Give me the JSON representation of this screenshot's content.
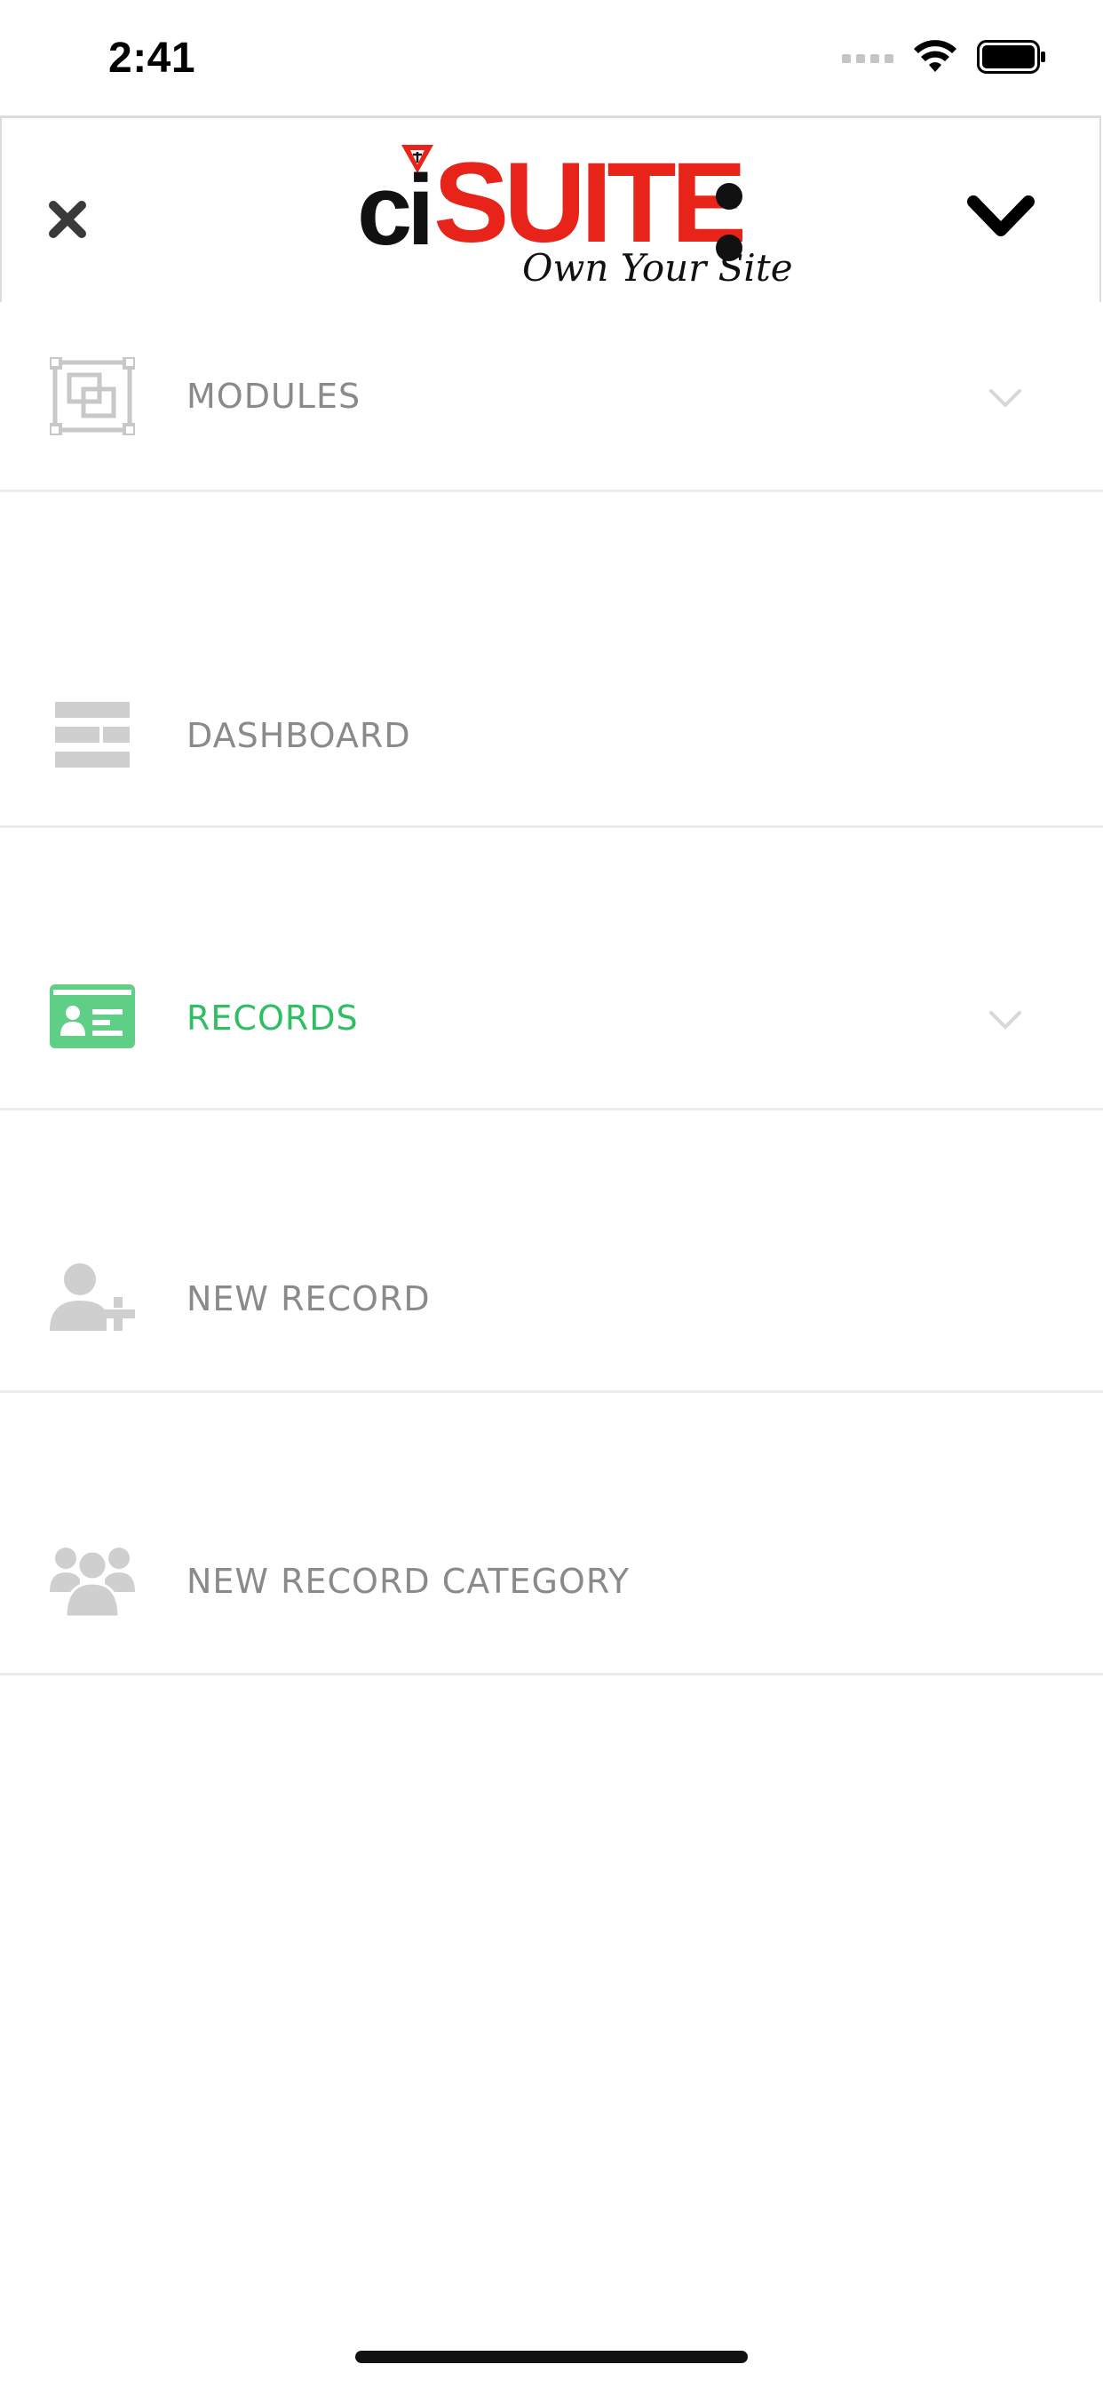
{
  "status_bar": {
    "time": "2:41"
  },
  "header": {
    "logo": {
      "brand_prefix": "ci",
      "brand_main": "SUITE",
      "tagline": "Own Your Site"
    },
    "close_icon": "close-icon",
    "collapse_icon": "chevron-down-icon"
  },
  "menu": {
    "items": [
      {
        "label": "MODULES",
        "icon": "modules-icon",
        "has_chevron": true,
        "active": false
      },
      {
        "label": "DASHBOARD",
        "icon": "dashboard-icon",
        "has_chevron": false,
        "active": false
      },
      {
        "label": "RECORDS",
        "icon": "records-card-icon",
        "has_chevron": true,
        "active": true
      },
      {
        "label": "NEW RECORD",
        "icon": "user-add-icon",
        "has_chevron": false,
        "active": false
      },
      {
        "label": "NEW RECORD CATEGORY",
        "icon": "users-group-icon",
        "has_chevron": false,
        "active": false
      }
    ]
  },
  "colors": {
    "accent_green": "#2ebf63",
    "brand_red": "#e8241a",
    "icon_gray": "#c8c8c8",
    "label_gray": "#8a8a8a",
    "divider": "#ececec"
  }
}
